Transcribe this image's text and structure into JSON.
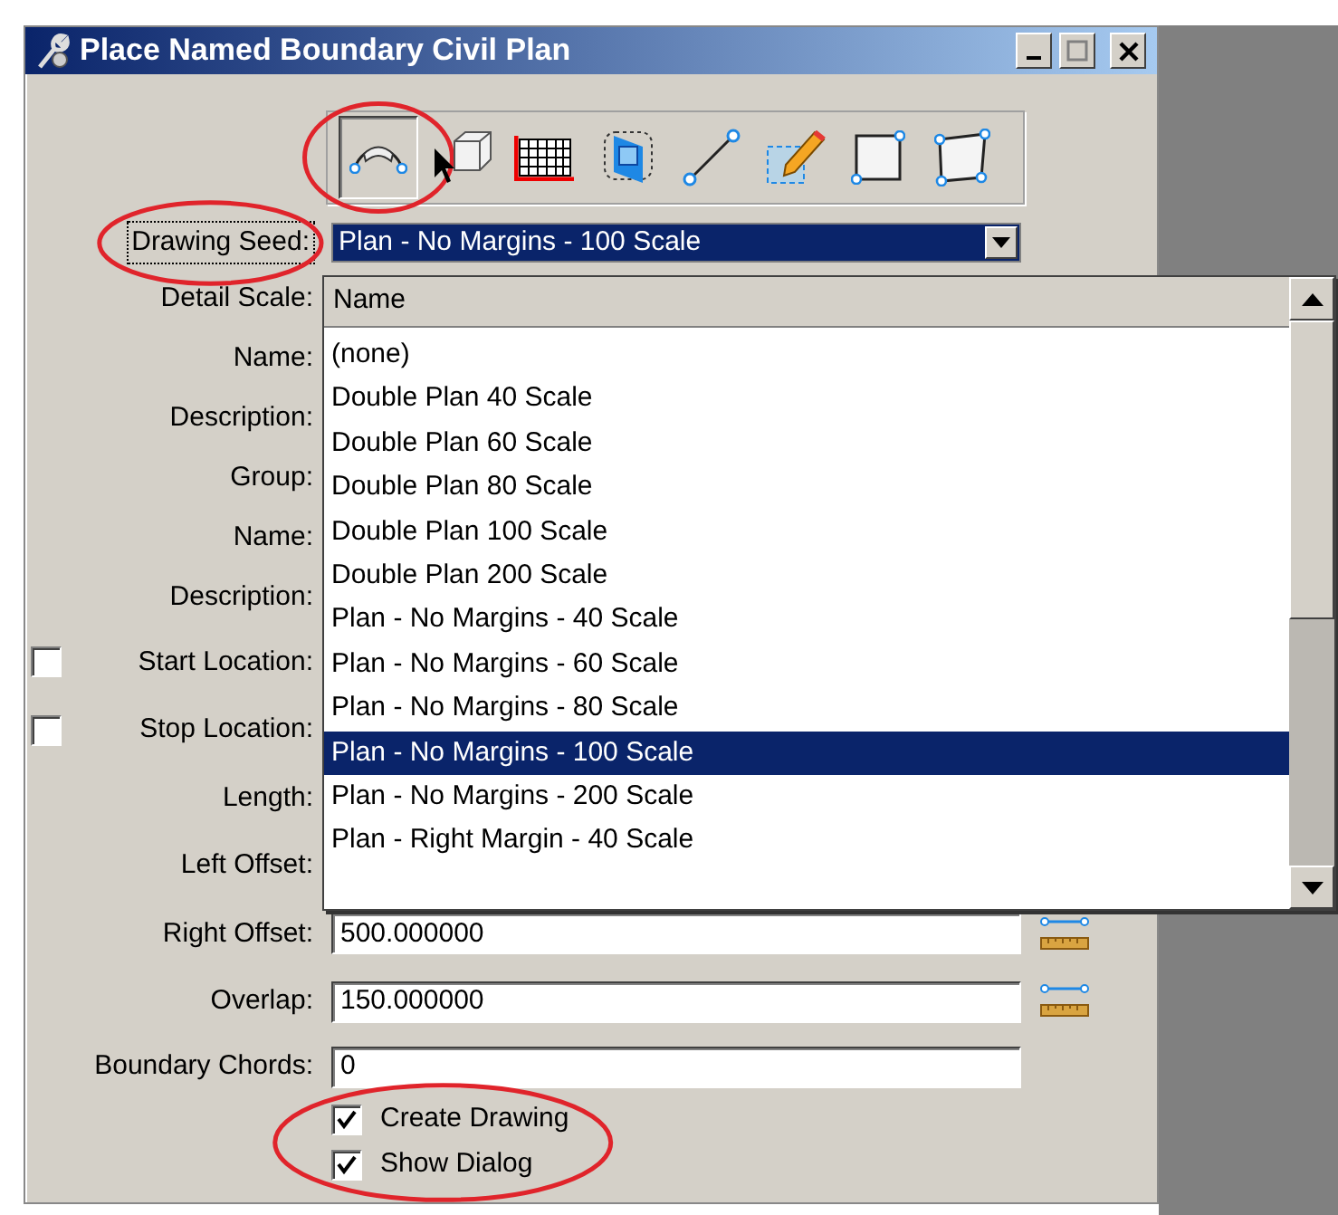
{
  "window": {
    "title": "Place Named Boundary Civil Plan"
  },
  "toolbar": [
    {
      "kind": "arc",
      "selected": true,
      "circled": true
    },
    {
      "kind": "cube",
      "selected": false
    },
    {
      "kind": "grid",
      "selected": false
    },
    {
      "kind": "frame",
      "selected": false
    },
    {
      "kind": "line",
      "selected": false
    },
    {
      "kind": "pencil",
      "selected": false
    },
    {
      "kind": "square",
      "selected": false
    },
    {
      "kind": "quad",
      "selected": false
    }
  ],
  "drawing_seed": {
    "label": "Drawing Seed:",
    "value": "Plan - No Margins - 100 Scale",
    "circled": true
  },
  "fields": [
    {
      "kind": "label",
      "label": "Detail Scale:"
    },
    {
      "kind": "label",
      "label": "Name:"
    },
    {
      "kind": "label",
      "label": "Description:"
    },
    {
      "kind": "label",
      "label": "Group:"
    },
    {
      "kind": "label",
      "label": "Name:"
    },
    {
      "kind": "label",
      "label": "Description:"
    },
    {
      "kind": "check",
      "label": "Start Location:",
      "checked": false
    },
    {
      "kind": "check",
      "label": "Stop Location:",
      "checked": false
    },
    {
      "kind": "label",
      "label": "Length:"
    },
    {
      "kind": "label",
      "label": "Left Offset:"
    },
    {
      "kind": "measure",
      "label": "Right Offset:",
      "value": "500.000000"
    },
    {
      "kind": "measure",
      "label": "Overlap:",
      "value": "150.000000"
    },
    {
      "kind": "text",
      "label": "Boundary Chords:",
      "value": "0"
    }
  ],
  "options": {
    "circled": true,
    "items": [
      {
        "label": "Create Drawing",
        "checked": true
      },
      {
        "label": "Show Dialog",
        "checked": true
      }
    ]
  },
  "dropdown": {
    "header": "Name",
    "items": [
      {
        "label": "(none)",
        "selected": false
      },
      {
        "label": "Double Plan 40 Scale",
        "selected": false
      },
      {
        "label": "Double Plan 60 Scale",
        "selected": false
      },
      {
        "label": "Double Plan 80 Scale",
        "selected": false
      },
      {
        "label": "Double Plan 100 Scale",
        "selected": false
      },
      {
        "label": "Double Plan 200 Scale",
        "selected": false
      },
      {
        "label": "Plan - No Margins - 40 Scale",
        "selected": false
      },
      {
        "label": "Plan - No Margins - 60 Scale",
        "selected": false
      },
      {
        "label": "Plan - No Margins - 80 Scale",
        "selected": false
      },
      {
        "label": "Plan - No Margins - 100 Scale",
        "selected": true
      },
      {
        "label": "Plan - No Margins - 200 Scale",
        "selected": false
      },
      {
        "label": "Plan - Right Margin - 40 Scale",
        "selected": false
      }
    ]
  }
}
